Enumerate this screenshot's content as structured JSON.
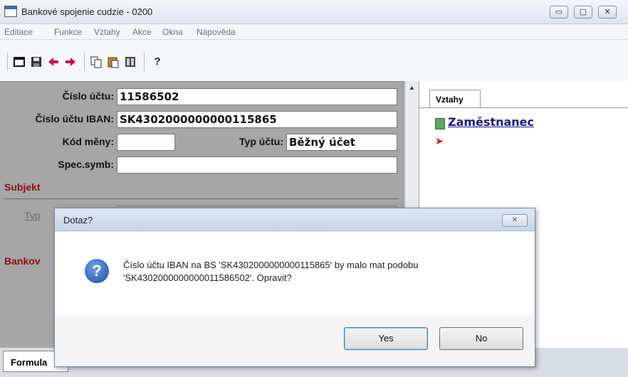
{
  "window": {
    "title": "Bankové spojenie cudzie - 0200",
    "controls": {
      "minimize": "▭",
      "maximize": "▢",
      "close": "✕"
    }
  },
  "menu": [
    "Editace",
    "Funkce",
    "Vztahy",
    "Akce",
    "Okna",
    "Nápověda"
  ],
  "toolbar": {
    "icons": [
      "window-icon",
      "save-icon",
      "arrow-left-icon",
      "arrow-right-icon",
      "copy-icon",
      "paste-icon",
      "grid-icon",
      "help-icon"
    ]
  },
  "form": {
    "cislo_uctu_label": "Číslo účtu:",
    "cislo_uctu_value": "11586502",
    "iban_label": "Číslo účtu IBAN:",
    "iban_value": "SK4302000000000115865",
    "kod_meny_label": "Kód měny:",
    "kod_meny_value": "",
    "typ_uctu_label": "Typ účtu:",
    "typ_uctu_value": "Běžný účet",
    "spec_symb_label": "Spec.symb:",
    "spec_symb_value": "",
    "subjekt_section": "Subjekt",
    "typ_label_partial": "Typ",
    "bankov_section_partial": "Bankov"
  },
  "right_panel": {
    "tab_label": "Vztahy",
    "item_label": "Zaměstnanec"
  },
  "bottom_tab": "Formula",
  "dialog": {
    "title": "Dotaz?",
    "message_line1": "Číslo účtu IBAN na BS 'SK4302000000000115865' by malo mat podobu",
    "message_line2": "'SK4302000000000011586502'. Opravit?",
    "yes_label": "Yes",
    "no_label": "No",
    "close_label": "✕"
  },
  "colors": {
    "form_background": "#a6a6a6",
    "section_label": "#8a1010",
    "link": "#1a1a8a"
  }
}
